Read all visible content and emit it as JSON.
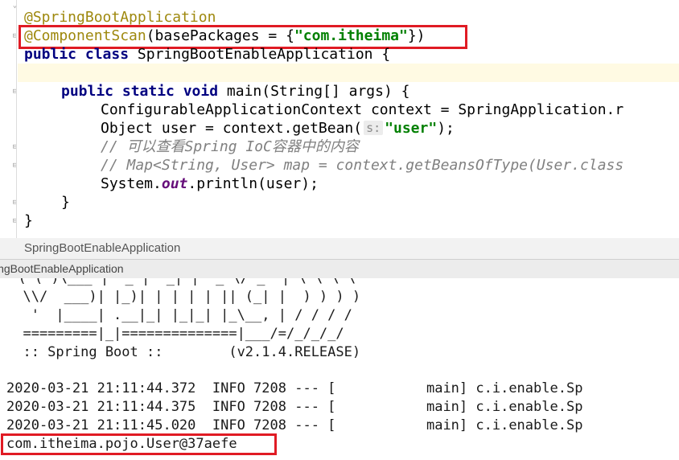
{
  "editor": {
    "lines": {
      "annot1": "@SpringBootApplication",
      "scan_annot": "@ComponentScan",
      "scan_mid": "(basePackages = {",
      "scan_str": "\"com.itheima\"",
      "scan_end": "})",
      "cls_kw": "public class ",
      "cls_rest": "SpringBootEnableApplication {",
      "main_kw": "public static void ",
      "main_rest": "main(String[] args) {",
      "ctx": "ConfigurableApplicationContext context = SpringApplication.r",
      "obj_pre": "Object user = context.getBean(",
      "obj_hint": "s:",
      "obj_str": "\"user\"",
      "obj_end": ");",
      "cmt1": "// 可以查看Spring IoC容器中的内容",
      "cmt2": "// Map<String, User> map = context.getBeansOfType(User.class",
      "sys_pre": "System.",
      "sys_field": "out",
      "sys_end": ".println(user);",
      "brace_inner": "}",
      "brace_outer": "}"
    }
  },
  "breadcrumb": {
    "label": "SpringBootEnableApplication"
  },
  "run_tab": {
    "label": "ingBootEnableApplication"
  },
  "console": {
    "banner": [
      "  \\\\/  ___)| |_)| | | | | || (_| |  ) ) ) )",
      "   '  |____| .__|_| |_|_| |_\\__, | / / / /",
      "  =========|_|==============|___/=/_/_/_/",
      "  :: Spring Boot ::        (v2.1.4.RELEASE)"
    ],
    "logs": [
      "2020-03-21 21:11:44.372  INFO 7208 --- [           main] c.i.enable.Sp",
      "2020-03-21 21:11:44.375  INFO 7208 --- [           main] c.i.enable.Sp",
      "2020-03-21 21:11:45.020  INFO 7208 --- [           main] c.i.enable.Sp"
    ],
    "output": "com.itheima.pojo.User@37aefe"
  },
  "colors": {
    "highlight_box": "#e01b24",
    "annotation": "#9e880d",
    "keyword": "#000080",
    "string": "#008000",
    "comment": "#808080"
  }
}
